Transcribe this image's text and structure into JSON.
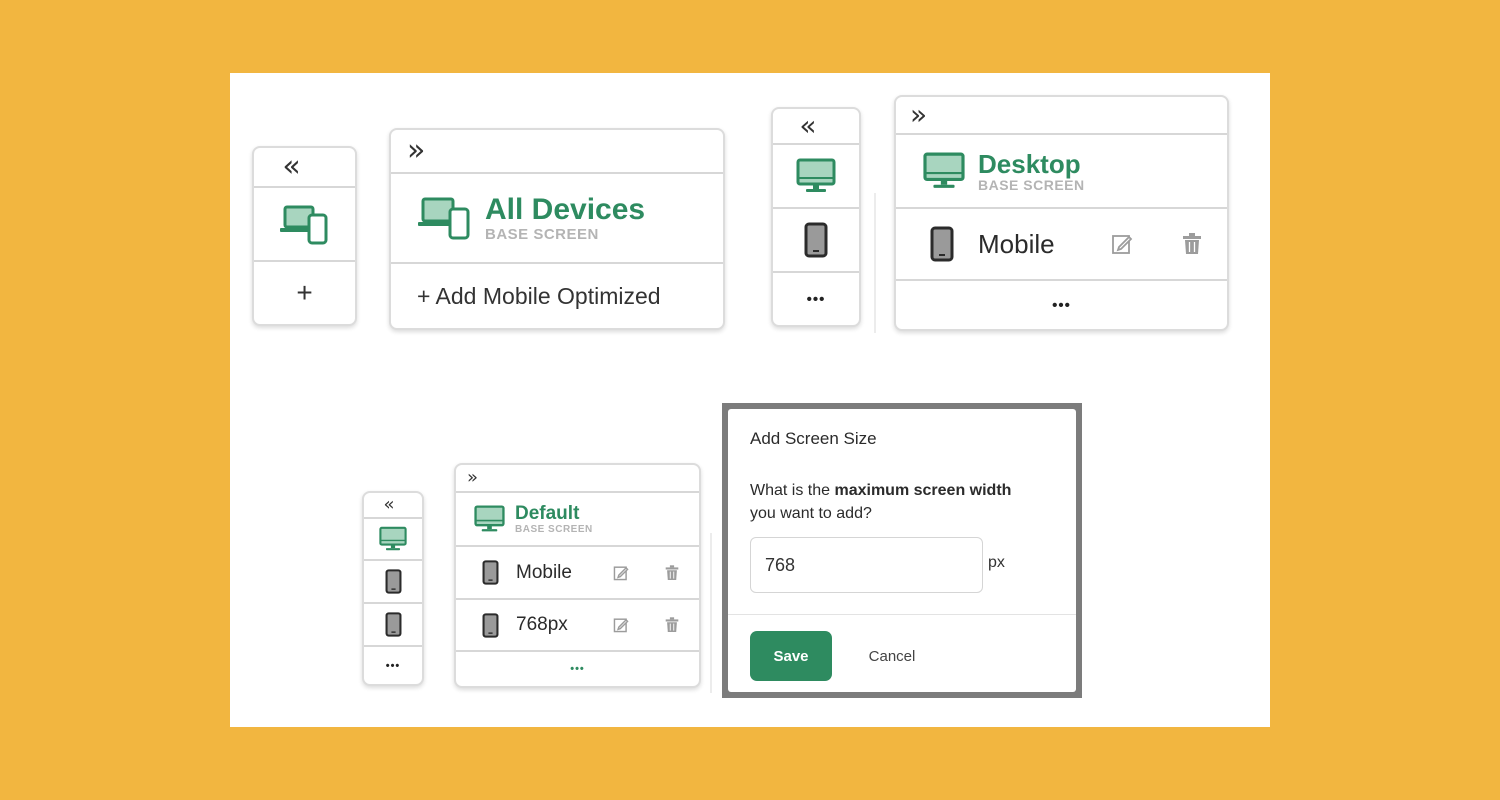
{
  "colors": {
    "accent": "#2E8B60",
    "background": "#F2B640",
    "canvas": "#FFFFFF"
  },
  "panel_a_collapsed": {
    "collapse_glyph": "«",
    "device_icon": "devices-icon",
    "add_glyph": "+"
  },
  "panel_b_expanded": {
    "expand_glyph": "»",
    "device_icon": "devices-icon",
    "title": "All Devices",
    "subtitle": "BASE SCREEN",
    "add_label": "+ Add Mobile Optimized"
  },
  "panel_c_collapsed": {
    "collapse_glyph": "«",
    "items": [
      {
        "icon": "desktop-icon",
        "active": true
      },
      {
        "icon": "mobile-icon",
        "active": false
      }
    ],
    "more_glyph": "•••"
  },
  "panel_d_expanded": {
    "expand_glyph": "»",
    "base": {
      "icon": "desktop-icon",
      "title": "Desktop",
      "subtitle": "BASE SCREEN"
    },
    "screens": [
      {
        "icon": "mobile-icon",
        "label": "Mobile",
        "edit_icon": "pencil-icon",
        "delete_icon": "trash-icon"
      }
    ],
    "more_glyph": "•••"
  },
  "panel_e_collapsed": {
    "collapse_glyph": "«",
    "items": [
      {
        "icon": "desktop-icon",
        "active": true
      },
      {
        "icon": "mobile-icon",
        "active": false
      },
      {
        "icon": "mobile-icon",
        "active": false
      }
    ],
    "more_glyph": "•••"
  },
  "panel_f_expanded": {
    "expand_glyph": "»",
    "base": {
      "icon": "desktop-icon",
      "title": "Default",
      "subtitle": "BASE SCREEN"
    },
    "screens": [
      {
        "icon": "mobile-icon",
        "label": "Mobile",
        "edit_icon": "pencil-icon",
        "delete_icon": "trash-icon"
      },
      {
        "icon": "mobile-icon",
        "label": "768px",
        "edit_icon": "pencil-icon",
        "delete_icon": "trash-icon"
      }
    ],
    "more_glyph": "•••"
  },
  "dialog": {
    "title": "Add Screen Size",
    "question_prefix": "What is the ",
    "question_bold": "maximum screen width",
    "question_suffix": " you want to add?",
    "input_value": "768",
    "unit": "px",
    "save_label": "Save",
    "cancel_label": "Cancel"
  }
}
